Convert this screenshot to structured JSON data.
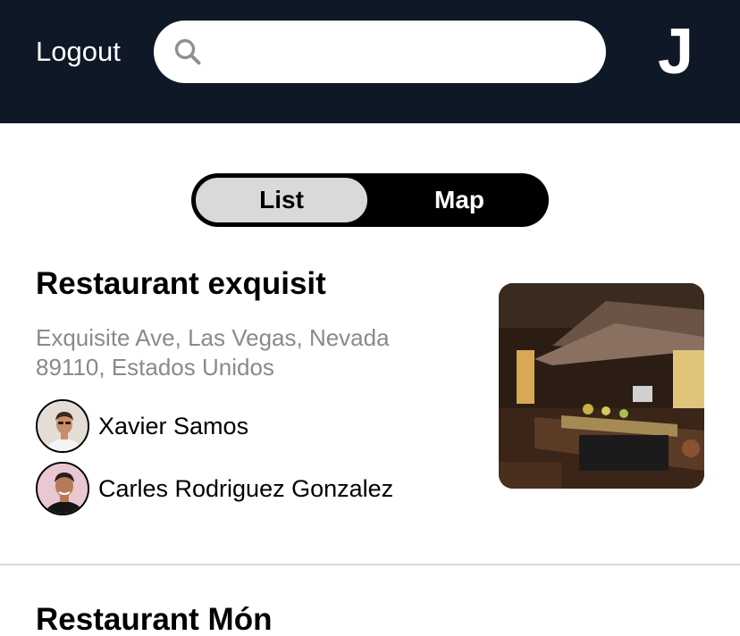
{
  "header": {
    "logout_label": "Logout",
    "search_placeholder": "",
    "search_value": "",
    "profile_initial": "J",
    "icons": {
      "search": "search-icon"
    }
  },
  "view_toggle": {
    "list_label": "List",
    "map_label": "Map",
    "selected": "List"
  },
  "restaurants": [
    {
      "name": "Restaurant exquisit",
      "address": "Exquisite Ave, Las Vegas, Nevada 89110, Estados Unidos",
      "people": [
        {
          "name": "Xavier Samos"
        },
        {
          "name": "Carles Rodriguez Gonzalez"
        }
      ]
    },
    {
      "name": "Restaurant Món"
    }
  ],
  "colors": {
    "header_bg": "#0f1826",
    "toggle_bg": "#000000",
    "toggle_selected_bg": "#d9d9d9",
    "address_text": "#8a8a8a",
    "divider": "#d6d6d6"
  }
}
